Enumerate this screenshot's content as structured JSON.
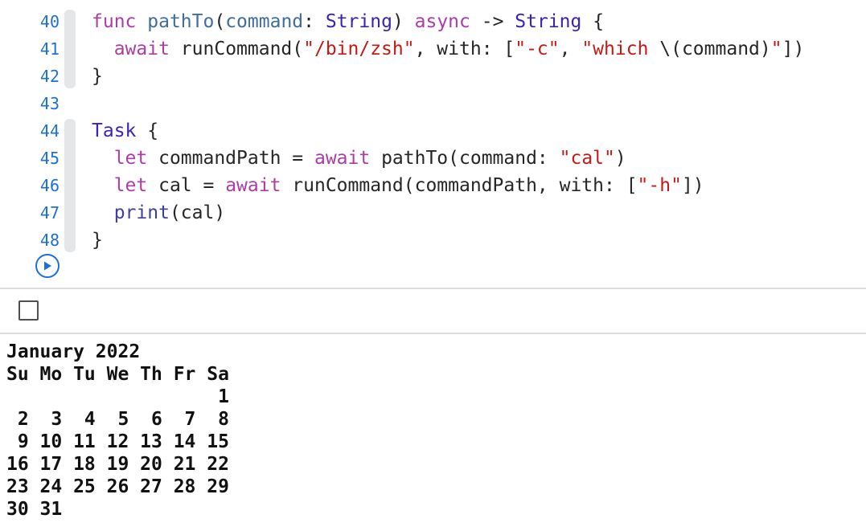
{
  "editor": {
    "line_numbers": [
      "40",
      "41",
      "42",
      "43",
      "44",
      "45",
      "46",
      "47",
      "48"
    ],
    "lines": [
      [
        {
          "t": "func",
          "c": "kw"
        },
        {
          "t": " ",
          "c": ""
        },
        {
          "t": "pathTo",
          "c": "fn"
        },
        {
          "t": "(",
          "c": ""
        },
        {
          "t": "command",
          "c": "fn"
        },
        {
          "t": ": ",
          "c": ""
        },
        {
          "t": "String",
          "c": "type"
        },
        {
          "t": ") ",
          "c": ""
        },
        {
          "t": "async",
          "c": "kw"
        },
        {
          "t": " -> ",
          "c": ""
        },
        {
          "t": "String",
          "c": "type"
        },
        {
          "t": " {",
          "c": ""
        }
      ],
      [
        {
          "t": "  ",
          "c": ""
        },
        {
          "t": "await",
          "c": "kw"
        },
        {
          "t": " runCommand(",
          "c": ""
        },
        {
          "t": "\"/bin/zsh\"",
          "c": "str"
        },
        {
          "t": ", with: [",
          "c": ""
        },
        {
          "t": "\"-c\"",
          "c": "str"
        },
        {
          "t": ", ",
          "c": ""
        },
        {
          "t": "\"which ",
          "c": "str"
        },
        {
          "t": "\\(command)",
          "c": ""
        },
        {
          "t": "\"",
          "c": "str"
        },
        {
          "t": "])",
          "c": ""
        }
      ],
      [
        {
          "t": "}",
          "c": ""
        }
      ],
      [],
      [
        {
          "t": "Task",
          "c": "type"
        },
        {
          "t": " {",
          "c": ""
        }
      ],
      [
        {
          "t": "  ",
          "c": ""
        },
        {
          "t": "let",
          "c": "kw"
        },
        {
          "t": " commandPath = ",
          "c": ""
        },
        {
          "t": "await",
          "c": "kw"
        },
        {
          "t": " pathTo(command: ",
          "c": ""
        },
        {
          "t": "\"cal\"",
          "c": "str"
        },
        {
          "t": ")",
          "c": ""
        }
      ],
      [
        {
          "t": "  ",
          "c": ""
        },
        {
          "t": "let",
          "c": "kw"
        },
        {
          "t": " cal = ",
          "c": ""
        },
        {
          "t": "await",
          "c": "kw"
        },
        {
          "t": " runCommand(commandPath, with: [",
          "c": ""
        },
        {
          "t": "\"-h\"",
          "c": "str"
        },
        {
          "t": "])",
          "c": ""
        }
      ],
      [
        {
          "t": "  ",
          "c": ""
        },
        {
          "t": "print",
          "c": "call"
        },
        {
          "t": "(cal)",
          "c": ""
        }
      ],
      [
        {
          "t": "}",
          "c": ""
        }
      ]
    ],
    "change_bars": [
      {
        "from": 0,
        "to": 2
      },
      {
        "from": 4,
        "to": 8
      }
    ]
  },
  "console": {
    "output_lines": [
      "January 2022",
      "Su Mo Tu We Th Fr Sa",
      "                   1",
      " 2  3  4  5  6  7  8",
      " 9 10 11 12 13 14 15",
      "16 17 18 19 20 21 22",
      "23 24 25 26 27 28 29",
      "30 31"
    ]
  },
  "colors": {
    "keyword": "#ad3da4",
    "string": "#c41a16",
    "type": "#3d22b3",
    "line_number": "#1d6fd8"
  },
  "icons": {
    "run": "play-circle-icon",
    "console_toggle": "checkbox-icon"
  }
}
